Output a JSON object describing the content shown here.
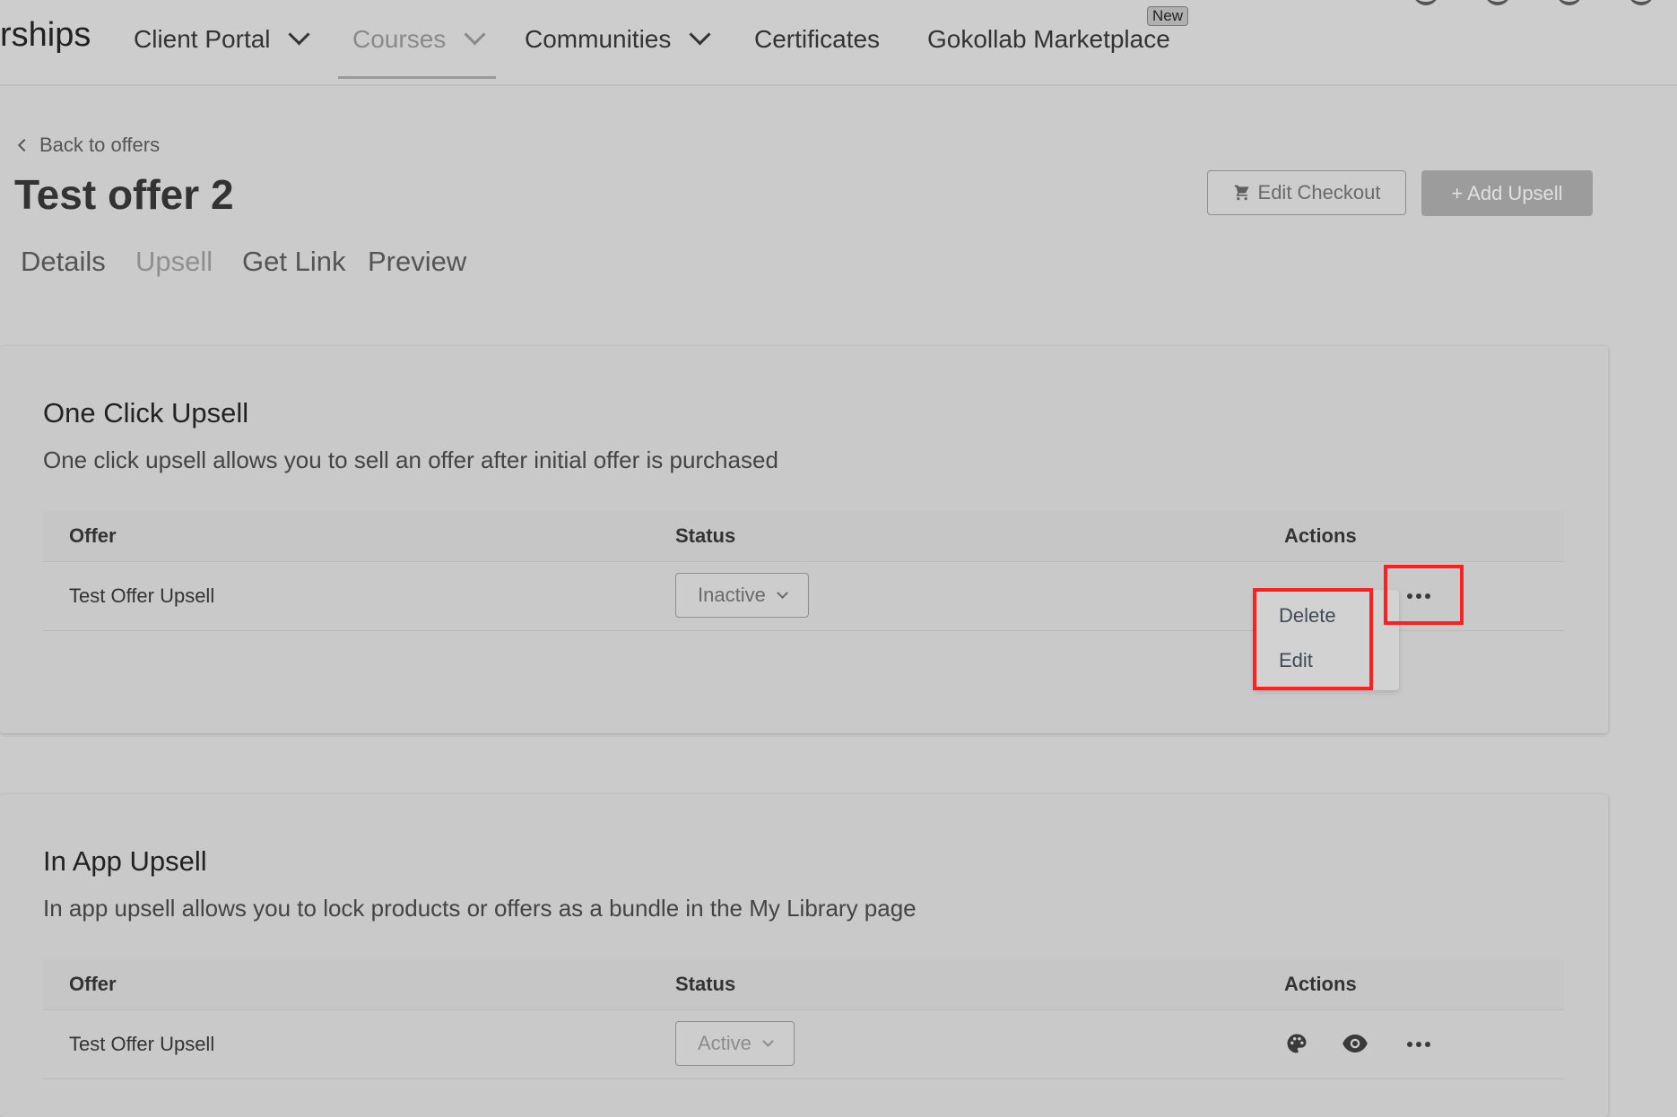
{
  "nav": {
    "brand": "rships",
    "items": [
      {
        "label": "Client Portal"
      },
      {
        "label": "Courses"
      },
      {
        "label": "Communities"
      },
      {
        "label": "Certificates"
      },
      {
        "label": "Gokollab Marketplace"
      }
    ],
    "new_badge": "New"
  },
  "page": {
    "back_label": "Back to offers",
    "title": "Test offer 2",
    "edit_checkout_label": "Edit Checkout",
    "add_upsell_label": "+ Add Upsell",
    "tabs": [
      {
        "label": "Details"
      },
      {
        "label": "Upsell"
      },
      {
        "label": "Get Link"
      },
      {
        "label": "Preview"
      }
    ]
  },
  "one_click": {
    "title": "One Click Upsell",
    "description": "One click upsell allows you to sell an offer after initial offer is purchased",
    "columns": {
      "offer": "Offer",
      "status": "Status",
      "actions": "Actions"
    },
    "row": {
      "offer": "Test Offer Upsell",
      "status": "Inactive"
    },
    "menu": {
      "delete": "Delete",
      "edit": "Edit"
    }
  },
  "in_app": {
    "title": "In App Upsell",
    "description": "In app upsell allows you to lock products or offers as a bundle in the My Library page",
    "columns": {
      "offer": "Offer",
      "status": "Status",
      "actions": "Actions"
    },
    "row": {
      "offer": "Test Offer Upsell",
      "status": "Active"
    }
  },
  "icons": {
    "cart": "cart-icon",
    "palette": "palette-icon",
    "eye": "eye-icon",
    "more": "more-horizontal-icon"
  },
  "colors": {
    "highlight": "#ff1f1f",
    "background": "#cbcbcb"
  }
}
